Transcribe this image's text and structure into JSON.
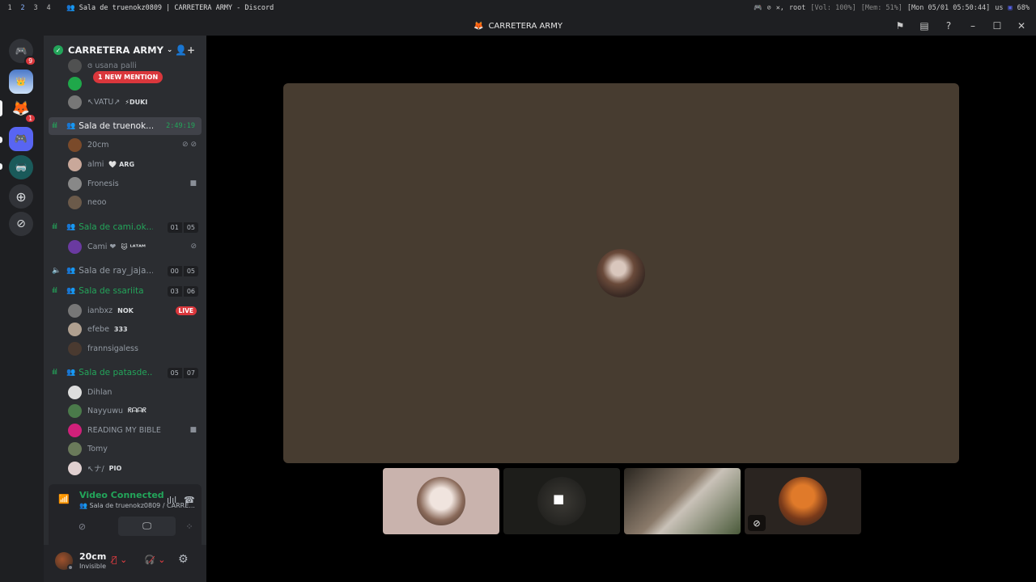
{
  "sysbar": {
    "workspaces": [
      "1",
      "2",
      "3",
      "4"
    ],
    "window_title": "👥 Sala de truenokz0809 | CARRETERA ARMY - Discord",
    "user": "root",
    "vol": "[Vol: 100%]",
    "mem": "[Mem: 51%]",
    "datetime": "[Mon 05/01  05:50:44]",
    "kbd": "us",
    "battery": "68%"
  },
  "titlebar": {
    "title": "CARRETERA ARMY"
  },
  "rail": {
    "dm_badge": "9",
    "server_badge": "1"
  },
  "server": {
    "name": "CARRETERA ARMY",
    "mention_pill": "1 NEW MENTION"
  },
  "channels": [
    {
      "name": "Sala de truenok...",
      "timer": "2:49:19",
      "users": [
        {
          "name": "20cm",
          "tag": ""
        },
        {
          "name": "almi",
          "tag": "🤍 ARG"
        },
        {
          "name": "Fronesis",
          "tag": ""
        },
        {
          "name": "neoo",
          "tag": ""
        }
      ]
    },
    {
      "name": "Sala de cami.ok...",
      "count_a": "01",
      "count_b": "05",
      "users": [
        {
          "name": "Cami ❤",
          "tag": "🐱 ᴸᴬᵀᴬᴹ"
        }
      ]
    },
    {
      "name": "Sala de ray_jaja...",
      "count_a": "00",
      "count_b": "05",
      "users": []
    },
    {
      "name": "Sala de ssariita",
      "count_a": "03",
      "count_b": "06",
      "users": [
        {
          "name": "ianbxz",
          "tag": "NOK"
        },
        {
          "name": "efebe",
          "tag": "333"
        },
        {
          "name": "frannsigaless",
          "tag": ""
        }
      ]
    },
    {
      "name": "Sala de patasde...",
      "count_a": "05",
      "count_b": "07",
      "users": [
        {
          "name": "Dihlan",
          "tag": ""
        },
        {
          "name": "Nayyuwu",
          "tag": "ᖇᗩᗩᖇ"
        },
        {
          "name": "READING MY BIBLE",
          "tag": ""
        },
        {
          "name": "Tomy",
          "tag": ""
        },
        {
          "name": "↖ナ/",
          "tag": "PIO"
        }
      ]
    }
  ],
  "top_partial": [
    {
      "name": "ɞ usana palli",
      "tag": ""
    },
    {
      "name": "↖VATU↗",
      "tag": "⚡DUKI"
    }
  ],
  "live_label": "LIVE",
  "voice": {
    "status": "Video Connected",
    "sub": "👥 Sala de truenokz0809 / CARRE..."
  },
  "me": {
    "name": "20cm",
    "status": "Invisible"
  },
  "colors": {
    "accent_green": "#23a55a",
    "danger_red": "#da373c",
    "sidebar": "#2b2d31",
    "rail": "#1e1f22",
    "main_tile": "#473c30"
  }
}
